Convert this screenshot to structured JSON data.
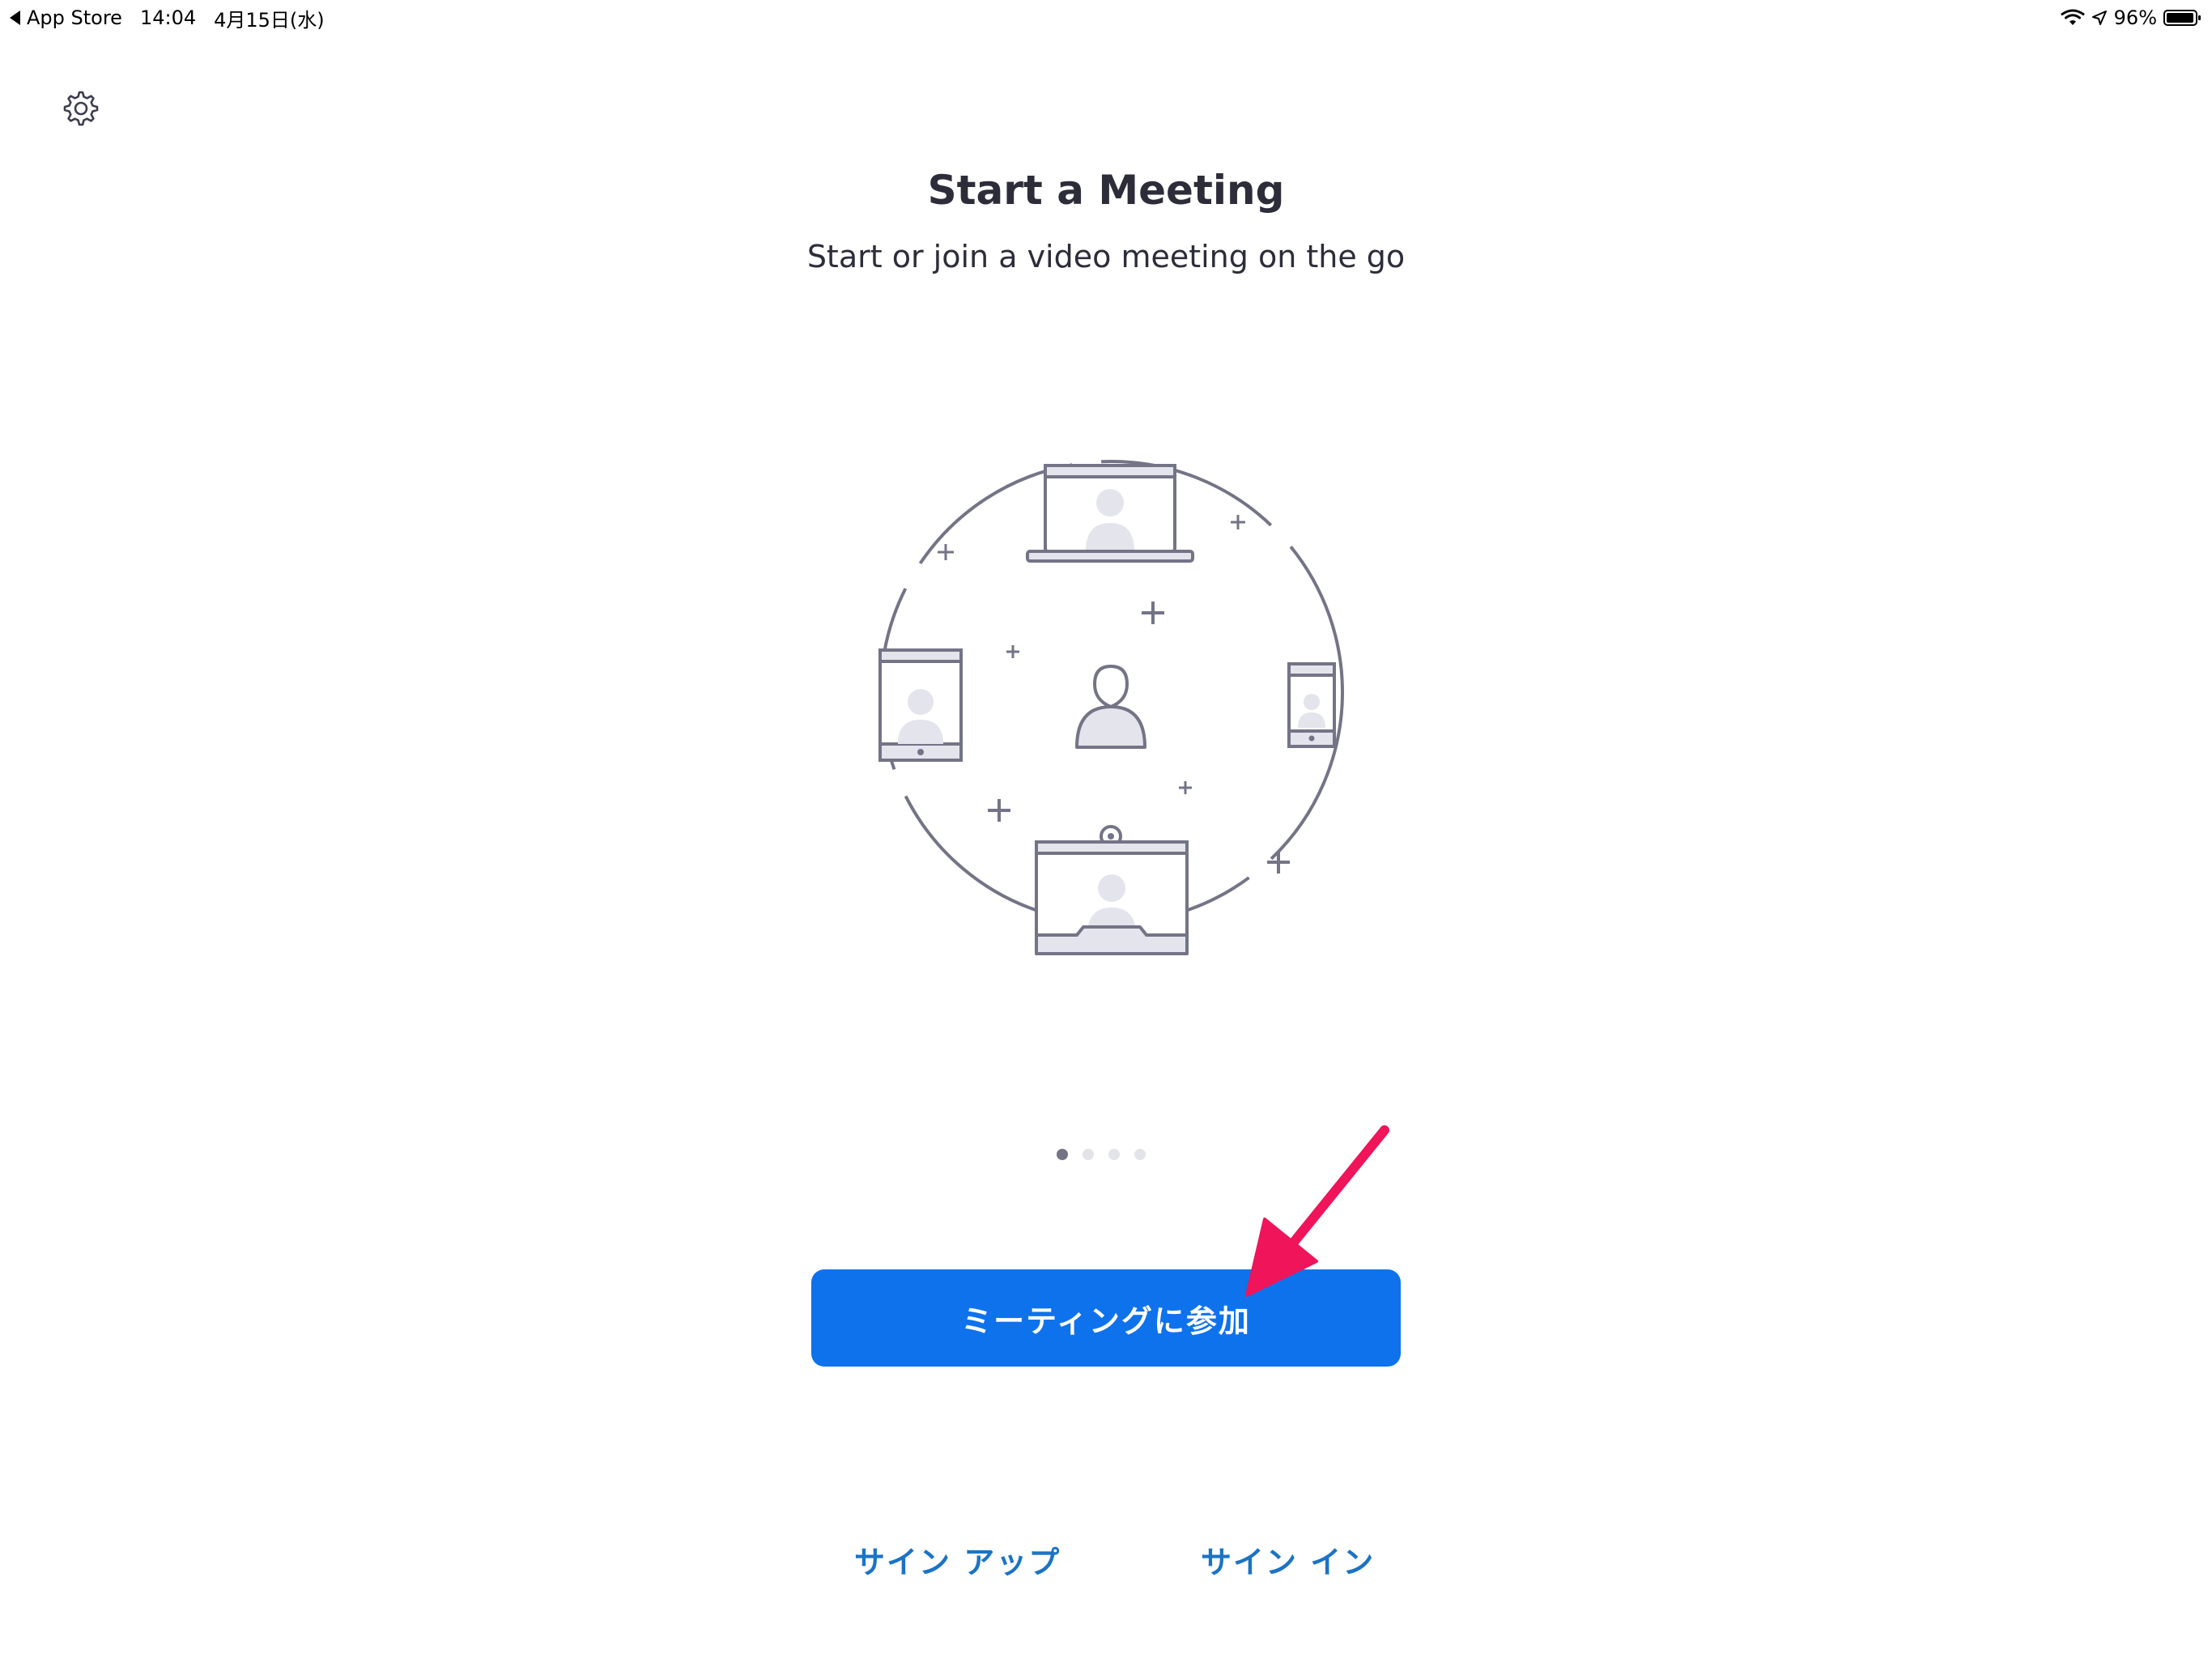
{
  "status_bar": {
    "back_app": "App Store",
    "time": "14:04",
    "date": "4月15日(水)",
    "battery": "96%"
  },
  "icons": {
    "settings": "gear-icon",
    "wifi": "wifi-icon",
    "location": "location-arrow-icon",
    "battery": "battery-icon"
  },
  "main": {
    "title": "Start a Meeting",
    "subtitle": "Start or join a video meeting on the go",
    "page_count": 4,
    "active_page": 1,
    "join_label": "ミーティングに参加",
    "signup_label": "サイン アップ",
    "signin_label": "サイン イン"
  },
  "colors": {
    "primary_button": "#0e72ed",
    "link": "#1c73c4",
    "annotation_arrow": "#f0145a",
    "illustration_stroke": "#747487",
    "illustration_fill": "#e4e4ec"
  }
}
